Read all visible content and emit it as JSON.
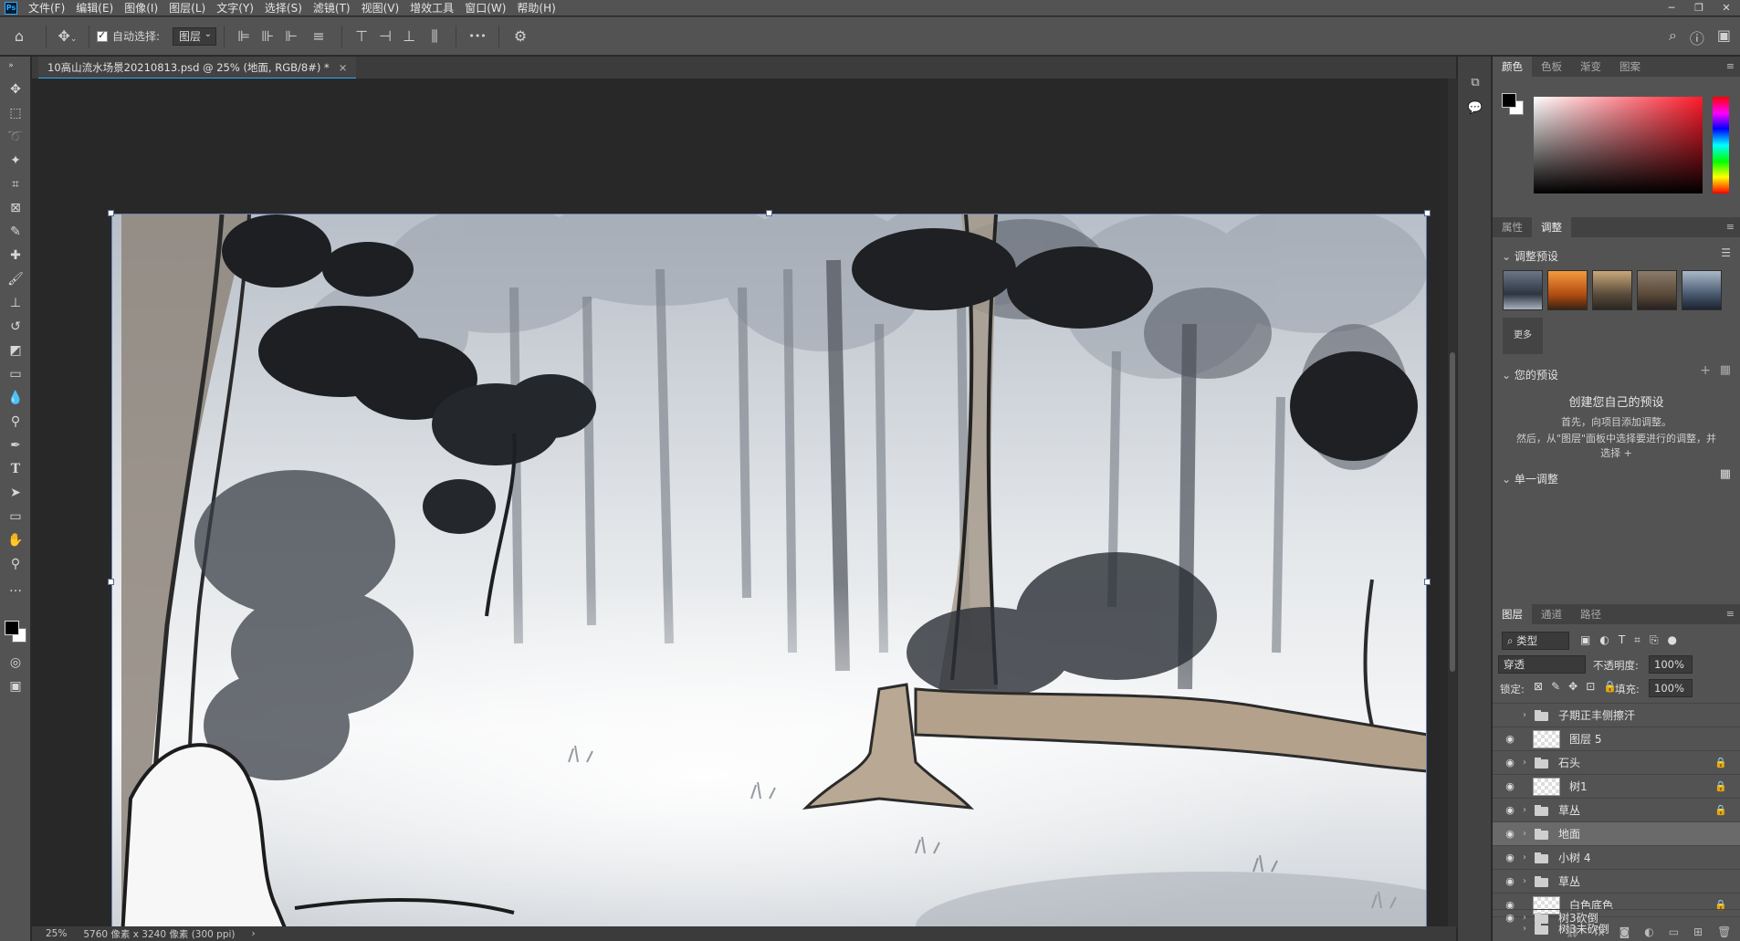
{
  "app": {
    "logo": "Ps"
  },
  "menu": [
    "文件(F)",
    "编辑(E)",
    "图像(I)",
    "图层(L)",
    "文字(Y)",
    "选择(S)",
    "滤镜(T)",
    "视图(V)",
    "增效工具",
    "窗口(W)",
    "帮助(H)"
  ],
  "options": {
    "auto_select_label": "自动选择:",
    "auto_select_target": "图层",
    "more": "•••"
  },
  "document": {
    "tab_title": "10高山流水场景20210813.psd @ 25% (地面, RGB/8#) *",
    "close": "×"
  },
  "status": {
    "zoom": "25%",
    "size": "5760 像素 x 3240 像素 (300 ppi)",
    "arrow": "›"
  },
  "color_panel": {
    "tabs": [
      "颜色",
      "色板",
      "渐变",
      "图案"
    ],
    "active_tab": "颜色",
    "foreground": "#000000",
    "background": "#ffffff",
    "hue_color": "#ff1b2b"
  },
  "adjust_panel": {
    "tabs": [
      "属性",
      "调整"
    ],
    "active_tab": "调整",
    "presets_title": "调整预设",
    "more_label": "更多",
    "your_presets_title": "您的预设",
    "create_title": "创建您自己的预设",
    "create_line1": "首先，向项目添加调整。",
    "create_line2": "然后，从\"图层\"面板中选择要进行的调整，并",
    "create_line3": "选择 +",
    "single_title": "单一调整"
  },
  "layers_panel": {
    "tabs": [
      "图层",
      "通道",
      "路径"
    ],
    "active_tab": "图层",
    "filter_label": "类型",
    "blend_mode": "穿透",
    "opacity_label": "不透明度:",
    "opacity_value": "100%",
    "lock_label": "锁定:",
    "fill_label": "填充:",
    "fill_value": "100%",
    "layers": [
      {
        "name": "子期正丰侧擦汗",
        "visible": false,
        "kind": "group",
        "locked": false,
        "selected": false
      },
      {
        "name": "图层 5",
        "visible": true,
        "kind": "layer",
        "locked": false,
        "selected": false
      },
      {
        "name": "石头",
        "visible": true,
        "kind": "group",
        "locked": true,
        "selected": false
      },
      {
        "name": "树1",
        "visible": true,
        "kind": "layer",
        "locked": true,
        "selected": false
      },
      {
        "name": "草丛",
        "visible": true,
        "kind": "group",
        "locked": true,
        "selected": false
      },
      {
        "name": "地面",
        "visible": true,
        "kind": "group",
        "locked": false,
        "selected": true
      },
      {
        "name": "小树 4",
        "visible": true,
        "kind": "group",
        "locked": false,
        "selected": false
      },
      {
        "name": "草丛",
        "visible": true,
        "kind": "group",
        "locked": false,
        "selected": false
      },
      {
        "name": "白色底色",
        "visible": true,
        "kind": "layer",
        "locked": true,
        "selected": false
      },
      {
        "name": "树3未砍倒",
        "visible": false,
        "kind": "group",
        "locked": false,
        "selected": false
      },
      {
        "name": "树3砍倒",
        "visible": true,
        "kind": "group",
        "locked": false,
        "selected": false
      }
    ]
  }
}
